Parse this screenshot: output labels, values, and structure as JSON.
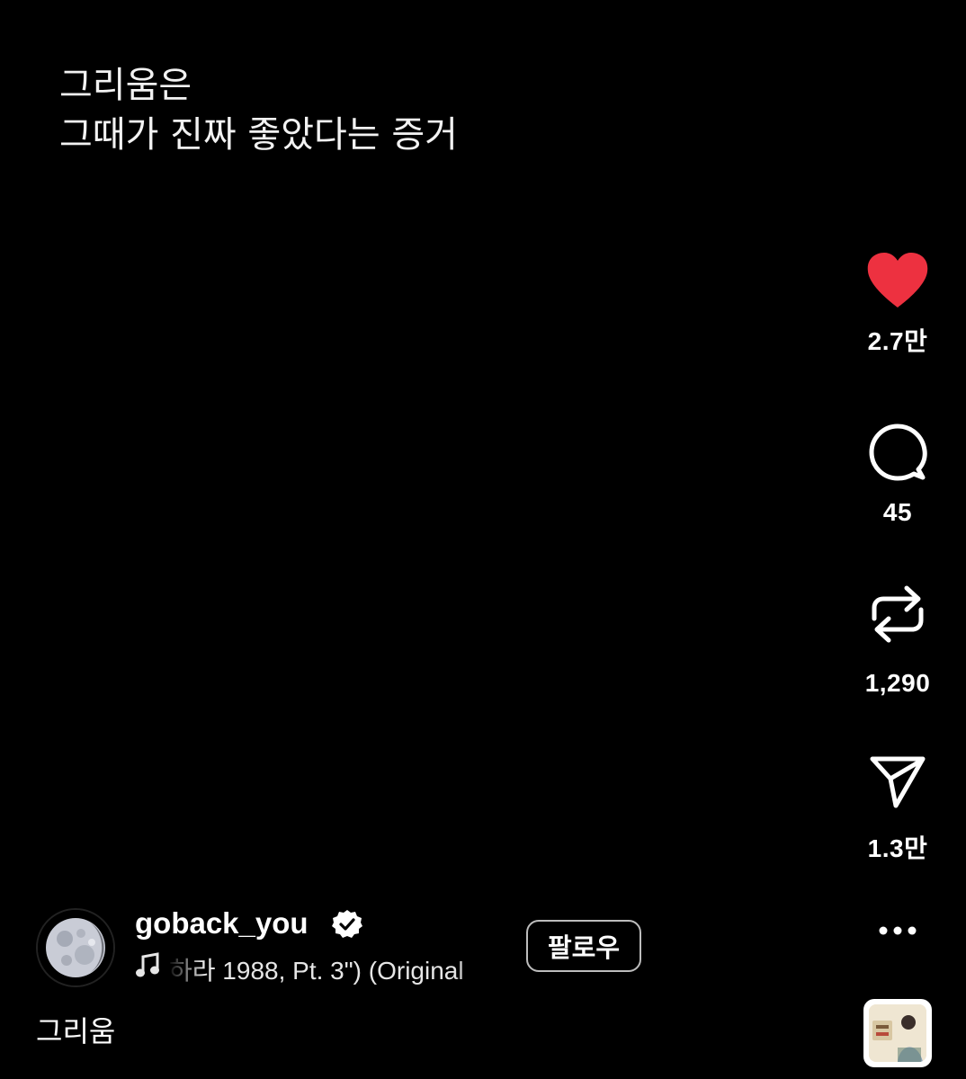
{
  "overlay": {
    "line1": "그리움은",
    "line2": "그때가 진짜 좋았다는 증거"
  },
  "actions": {
    "like": {
      "icon": "heart-icon",
      "count": "2.7만",
      "color": "#ed3140",
      "liked": true
    },
    "comment": {
      "icon": "comment-bubble-icon",
      "count": "45"
    },
    "repost": {
      "icon": "repost-icon",
      "count": "1,290"
    },
    "share": {
      "icon": "paper-plane-icon",
      "count": "1.3만"
    },
    "more": {
      "icon": "more-horizontal-icon"
    }
  },
  "author": {
    "username": "goback_you",
    "verified": true,
    "avatar_icon": "moon-avatar",
    "music_icon": "music-note-icon",
    "music_text": "하라 1988, Pt. 3\") (Original",
    "follow_label": "팔로우"
  },
  "caption": "그리움",
  "audio_thumbnail": {
    "icon": "audio-thumbnail"
  }
}
